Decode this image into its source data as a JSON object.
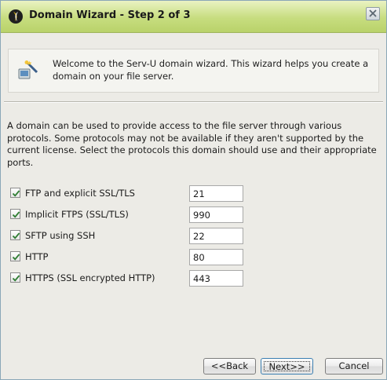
{
  "window": {
    "title": "Domain Wizard - Step 2 of 3",
    "app_icon": "serv-u-logo-icon",
    "close_icon": "close-icon"
  },
  "banner": {
    "icon": "wizard-icon",
    "text": "Welcome to the Serv-U domain wizard. This wizard helps you create a domain on your file server."
  },
  "description": "A domain can be used to provide access to the file server through various protocols. Some protocols may not be available if they aren't supported by the current license. Select the protocols this domain should use and their appropriate ports.",
  "protocols": [
    {
      "label": "FTP and explicit SSL/TLS",
      "checked": true,
      "port": "21"
    },
    {
      "label": "Implicit FTPS (SSL/TLS)",
      "checked": true,
      "port": "990"
    },
    {
      "label": "SFTP using SSH",
      "checked": true,
      "port": "22"
    },
    {
      "label": "HTTP",
      "checked": true,
      "port": "80"
    },
    {
      "label": "HTTPS (SSL encrypted HTTP)",
      "checked": true,
      "port": "443"
    }
  ],
  "buttons": {
    "back": "<<Back",
    "next": "Next>>",
    "cancel": "Cancel"
  },
  "colors": {
    "titlebar": "#c7dd7f",
    "window_bg": "#ecebe6",
    "check_mark": "#2e7d32"
  }
}
